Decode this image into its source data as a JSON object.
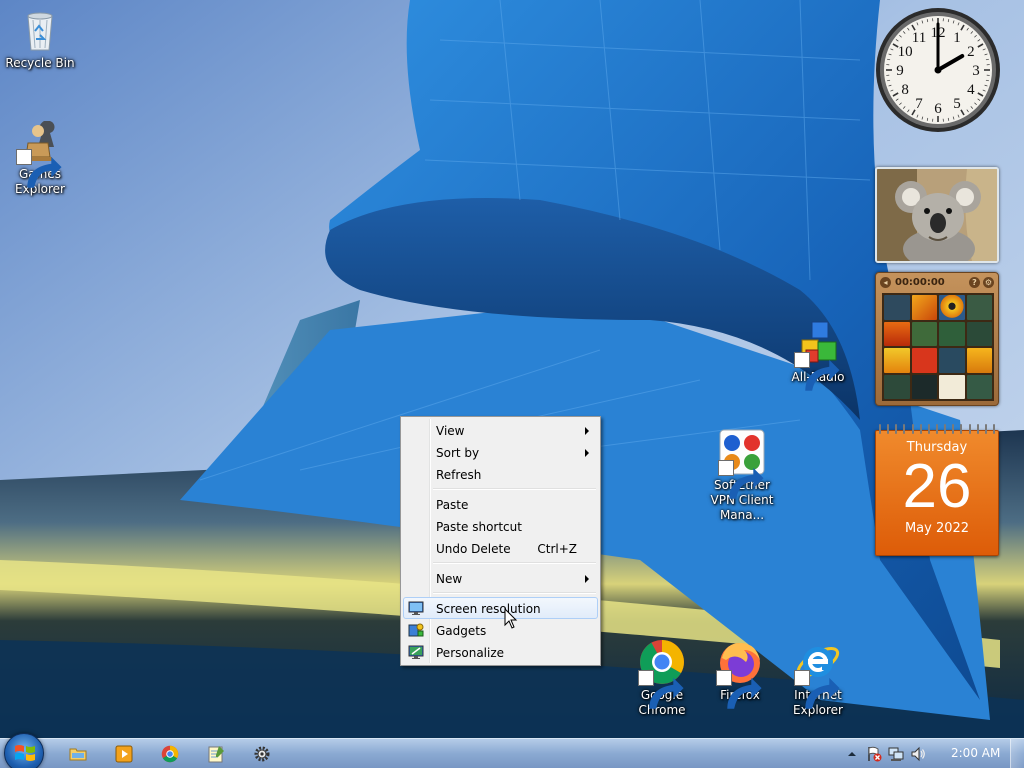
{
  "desktop": {
    "icons": [
      {
        "label": "Recycle Bin",
        "icon": "recycle-bin-icon"
      },
      {
        "label": "Games Explorer",
        "icon": "games-explorer-icon"
      },
      {
        "label": "All-Radio",
        "icon": "all-radio-icon"
      },
      {
        "label": "SoftEther VPN Client Mana...",
        "icon": "softether-vpn-icon"
      },
      {
        "label": "Google Chrome",
        "icon": "chrome-icon"
      },
      {
        "label": "Firefox",
        "icon": "firefox-icon"
      },
      {
        "label": "Internet Explorer",
        "icon": "internet-explorer-icon"
      }
    ]
  },
  "gadgets": {
    "clock": {
      "hour": 2,
      "minute": 0,
      "numerals": [
        "12",
        "1",
        "2",
        "3",
        "4",
        "5",
        "6",
        "7",
        "8",
        "9",
        "10",
        "11"
      ]
    },
    "slideshow": {
      "subject": "koala"
    },
    "puzzle": {
      "timer": "00:00:00"
    },
    "calendar": {
      "weekday": "Thursday",
      "day": "26",
      "month_year": "May 2022"
    }
  },
  "context_menu": {
    "items": [
      {
        "label": "View",
        "submenu": true
      },
      {
        "label": "Sort by",
        "submenu": true
      },
      {
        "label": "Refresh"
      },
      {
        "separator": true
      },
      {
        "label": "Paste"
      },
      {
        "label": "Paste shortcut"
      },
      {
        "label": "Undo Delete",
        "shortcut": "Ctrl+Z"
      },
      {
        "separator": true
      },
      {
        "label": "New",
        "submenu": true
      },
      {
        "separator": true
      },
      {
        "label": "Screen resolution",
        "icon": "screen-resolution-icon",
        "highlighted": true
      },
      {
        "label": "Gadgets",
        "icon": "gadgets-icon"
      },
      {
        "label": "Personalize",
        "icon": "personalize-icon"
      }
    ]
  },
  "taskbar": {
    "start_icon": "windows-logo-icon",
    "pinned": [
      "file-explorer-icon",
      "media-player-icon",
      "chrome-icon",
      "notepad-icon",
      "settings-gear-icon"
    ],
    "tray": [
      "show-hidden-icons-arrow",
      "action-center-flag-icon",
      "network-icon",
      "volume-icon"
    ],
    "time": "2:00 AM"
  },
  "colors": {
    "menu_bg": "#f0f0f0",
    "menu_highlight_border": "#aecff7",
    "calendar_orange": "#e96c14",
    "sky": "#7fa6d6",
    "building_blue": "#1f6fc4"
  }
}
